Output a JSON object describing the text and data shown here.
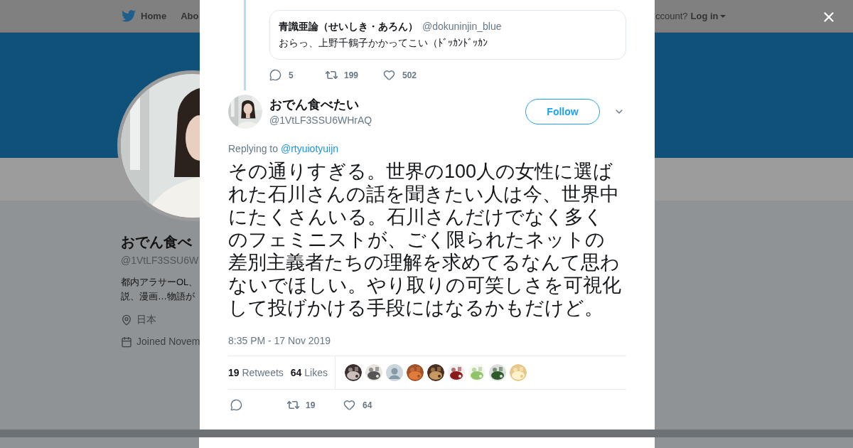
{
  "nav": {
    "items": [
      {
        "label": "Home"
      },
      {
        "label": "Abo"
      }
    ],
    "account_prompt": "ccount?",
    "login": "Log in"
  },
  "profile": {
    "name": "おでん食べ",
    "handle": "@1VtLF3SSU6W",
    "bio_lines": [
      "都内アラサーOL、",
      "説、漫画…物語が"
    ],
    "location": "日本",
    "joined": "Joined Novem"
  },
  "modal": {
    "quoted": {
      "name": "青識亜論（せいしき・あろん）",
      "handle": "@dokuninjin_blue",
      "text": "おらっ、上野千鶴子かかってこい（ﾄﾞｯｶﾝﾄﾞｯｶﾝ",
      "replies": "5",
      "retweets": "199",
      "likes": "502"
    },
    "tweet": {
      "name": "おでん食べたい",
      "handle": "@1VtLF3SSU6WHrAQ",
      "follow": "Follow",
      "replying_label": "Replying to",
      "replying_to": "@rtyuiotyuijn",
      "body_lines": [
        "その通りすぎる。世界の100人の女性に選ば",
        "れた石川さんの話を聞きたい人は今、世界中",
        "にたくさんいる。石川さんだけでなく多く",
        "のフェミニストが、ごく限られたネットの",
        "差別主義者たちの理解を求めてるなんて思わ",
        "ないでほしい。やり取りの可笑しさを可視化",
        "して投げかける手段にはなるかもだけど。"
      ],
      "time": "8:35 PM - 17 Nov 2019",
      "retweet_count": "19",
      "retweet_label": "Retweets",
      "like_count": "64",
      "like_label": "Likes",
      "likers": [
        {
          "kind": "picture"
        },
        {
          "kind": "picture"
        },
        {
          "kind": "default"
        },
        {
          "kind": "picture"
        },
        {
          "kind": "picture"
        },
        {
          "kind": "picture"
        },
        {
          "kind": "picture"
        },
        {
          "kind": "picture"
        },
        {
          "kind": "picture"
        }
      ],
      "action_retweets": "19",
      "action_likes": "64"
    }
  }
}
